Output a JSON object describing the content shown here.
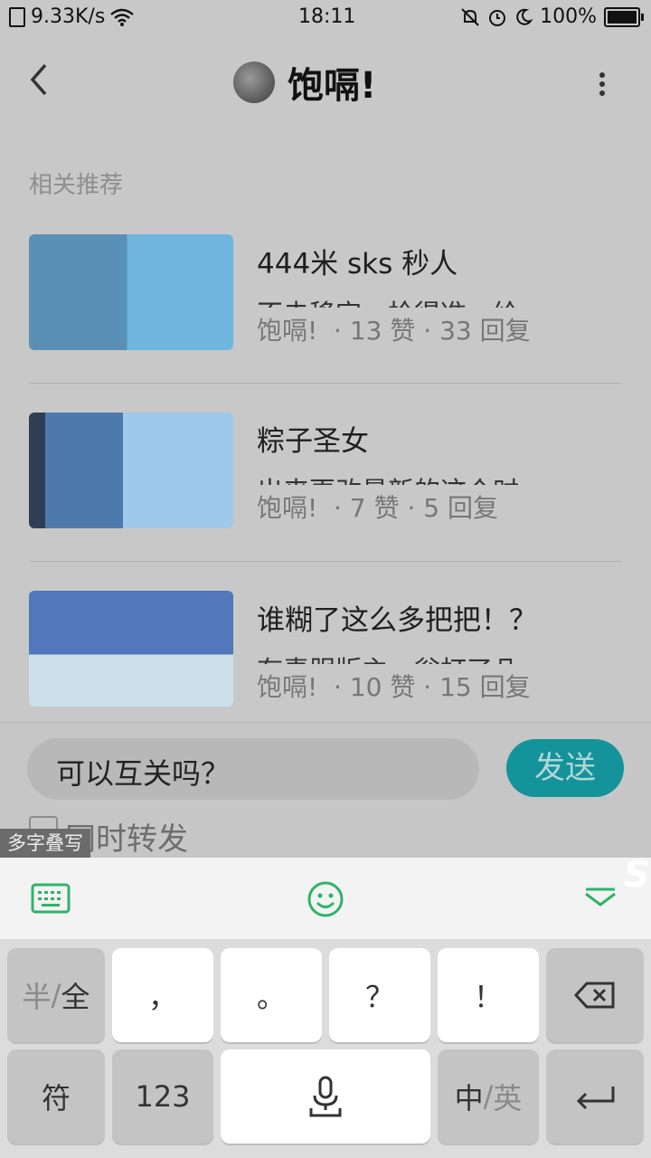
{
  "status_bar": {
    "net_speed": "9.33K/s",
    "time": "18:11",
    "battery": "100%",
    "battery_level": 1.0
  },
  "header": {
    "title": "饱嗝!"
  },
  "related": {
    "section_label": "相关推荐",
    "items": [
      {
        "title": "444米 sks 秒人",
        "snippet": "不击移定，枪得准，给",
        "author": "饱嗝!",
        "likes": "· 13 赞",
        "replies": "· 33 回复"
      },
      {
        "title": "粽子圣女",
        "snippet": "出来更改最新的这个时",
        "author": "饱嗝!",
        "likes": "· 7 赞",
        "replies": "· 5 回复"
      },
      {
        "title": "谁糊了这么多把把！？",
        "snippet": "有素服版主一翁打了几",
        "author": "饱嗝!",
        "likes": "· 10 赞",
        "replies": "· 15 回复"
      }
    ]
  },
  "comment": {
    "input_value": "可以互关吗？",
    "send_label": "发送",
    "forward_label": "同时转发",
    "forward_checked": false
  },
  "ime": {
    "multi_label": "多字叠写",
    "logo": "S",
    "row1": {
      "halfwidth_a": "半",
      "halfwidth_sep": "/",
      "halfwidth_b": "全",
      "comma": "，",
      "period": "。",
      "question": "？",
      "exclaim": "！"
    },
    "row2": {
      "symbol": "符",
      "numbers": "123",
      "lang_a": "中",
      "lang_sep": "/",
      "lang_b": "英"
    }
  },
  "colors": {
    "send_bg": "#14939a",
    "ime_accent": "#2fb36a"
  }
}
